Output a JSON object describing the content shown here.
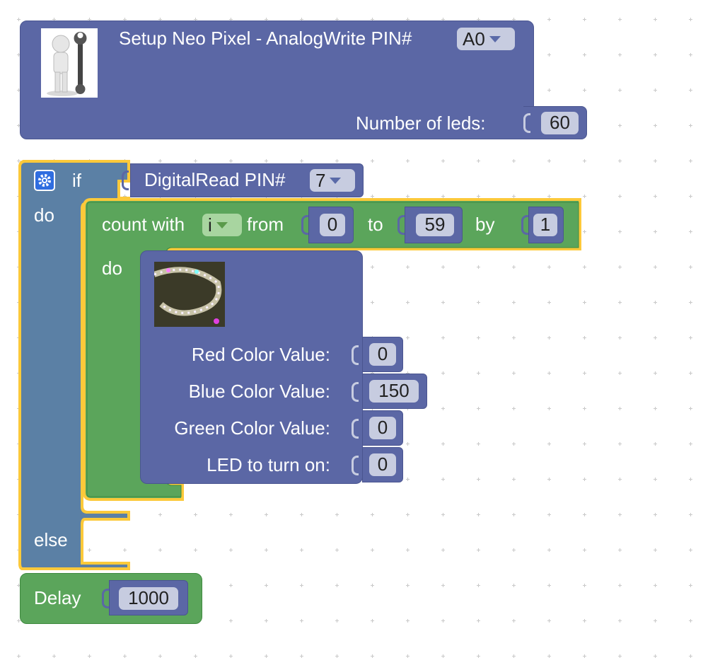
{
  "setup_block": {
    "title": "Setup Neo Pixel - AnalogWrite PIN#",
    "pin_value": "A0",
    "leds_label": "Number of leds:",
    "leds_value": "60",
    "image_icon": "mechanic-with-wrench-icon"
  },
  "if_block": {
    "if_label": "if",
    "do_label": "do",
    "else_label": "else",
    "gear_icon": "gear-icon",
    "condition": {
      "label": "DigitalRead PIN#",
      "pin_value": "7"
    }
  },
  "count_block": {
    "label": "count with",
    "var_value": "i",
    "from_label": "from",
    "from_value": "0",
    "to_label": "to",
    "to_value": "59",
    "by_label": "by",
    "by_value": "1",
    "do_label": "do"
  },
  "neopixel_block": {
    "image_icon": "led-strip-photo-icon",
    "rows": [
      {
        "label": "Red Color Value:",
        "value": "0"
      },
      {
        "label": "Blue Color Value:",
        "value": "150"
      },
      {
        "label": "Green Color Value:",
        "value": "0"
      },
      {
        "label": "LED to turn on:",
        "value": "0"
      }
    ]
  },
  "delay_block": {
    "label": "Delay",
    "value": "1000"
  },
  "colors": {
    "purple_block": "#5b67a5",
    "blue_block": "#5b80a5",
    "green_block": "#5ba55b",
    "selected_outline": "#fcc93a"
  }
}
